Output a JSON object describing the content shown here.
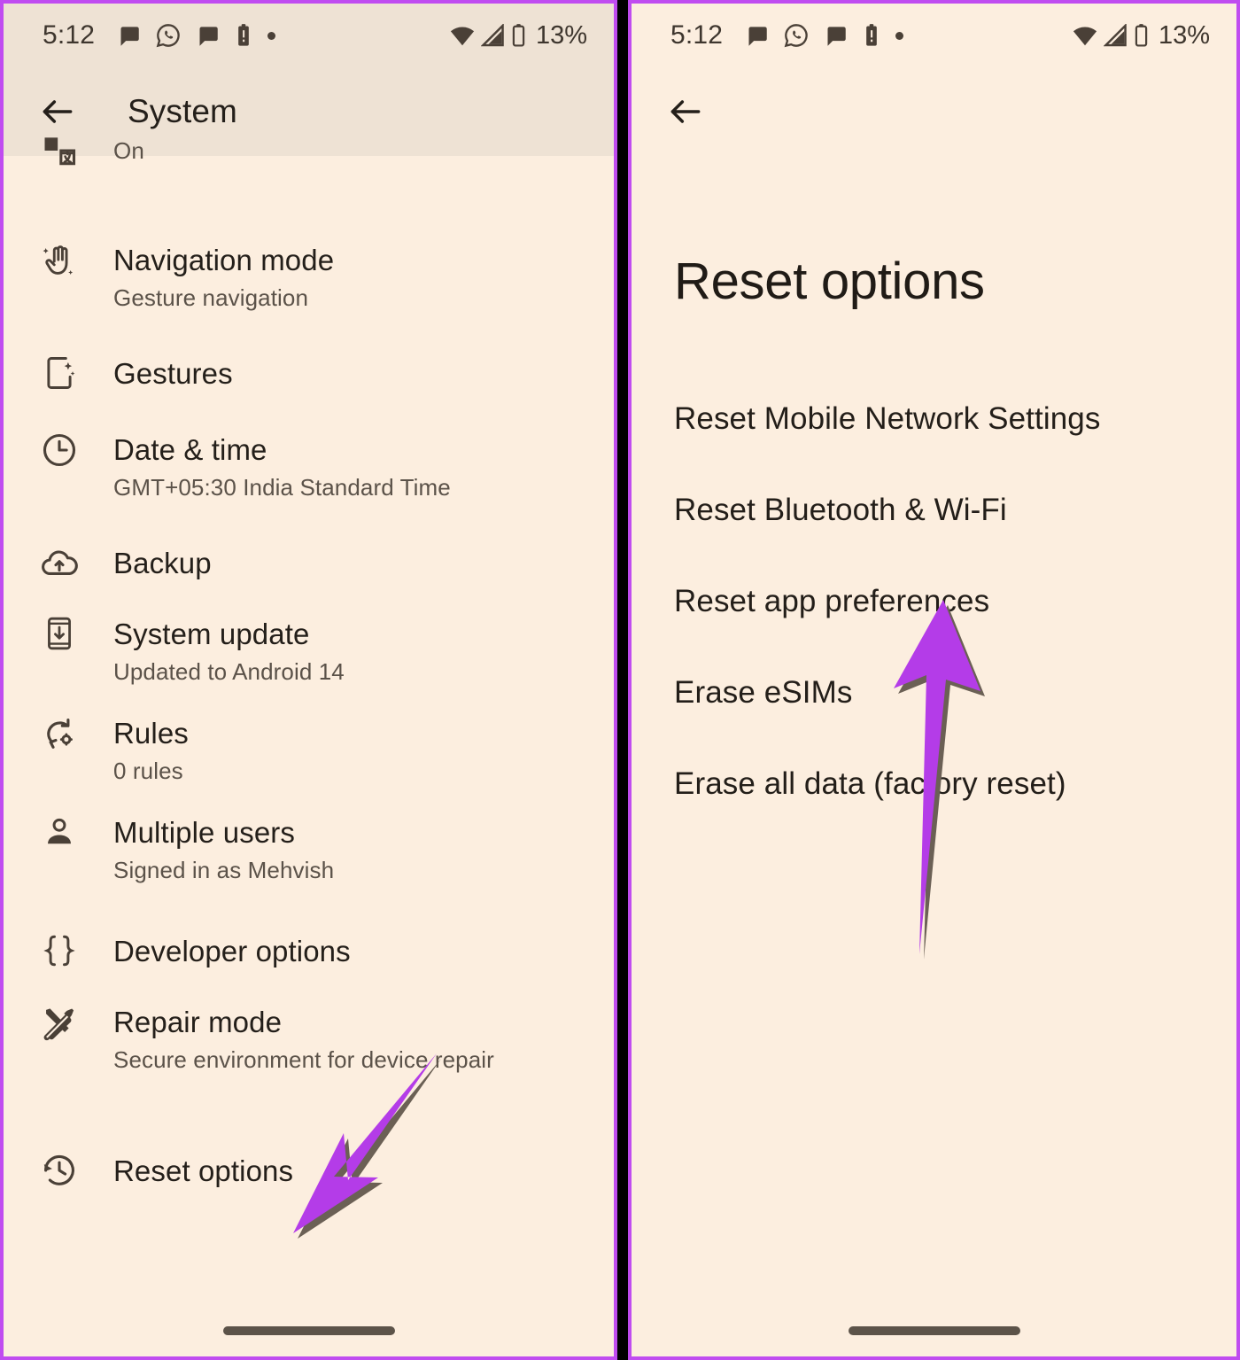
{
  "meta": {
    "accent_purple": "#B43CE8",
    "frame_border": "#C04CF0",
    "bg": "#FCEEDF",
    "appbar_bg": "#EEE2D4",
    "text_primary": "#241F1A",
    "text_secondary": "#5B5249"
  },
  "status_bar": {
    "time": "5:12",
    "battery_percent": "13%",
    "left_icons": [
      "chat-bubble-icon",
      "whatsapp-icon",
      "chat-bubble-icon",
      "battery-alert-icon",
      "dot-icon"
    ],
    "right_icons": [
      "wifi-icon",
      "cellular-signal-icon",
      "battery-icon"
    ]
  },
  "left_screen": {
    "appbar": {
      "back_icon": "back-arrow-icon",
      "title": "System"
    },
    "items": [
      {
        "icon": "translate-icon",
        "title": "",
        "subtitle": "On",
        "clipped": true
      },
      {
        "icon": "gesture-hand-icon",
        "title": "Navigation mode",
        "subtitle": "Gesture navigation",
        "clipped": false
      },
      {
        "icon": "phone-sparkle-icon",
        "title": "Gestures",
        "subtitle": "",
        "clipped": false
      },
      {
        "icon": "clock-icon",
        "title": "Date & time",
        "subtitle": "GMT+05:30 India Standard Time",
        "clipped": false
      },
      {
        "icon": "cloud-upload-icon",
        "title": "Backup",
        "subtitle": "",
        "clipped": false
      },
      {
        "icon": "system-update-icon",
        "title": "System update",
        "subtitle": "Updated to Android 14",
        "clipped": false
      },
      {
        "icon": "rules-gear-icon",
        "title": "Rules",
        "subtitle": "0 rules",
        "clipped": false
      },
      {
        "icon": "person-icon",
        "title": "Multiple users",
        "subtitle": "Signed in as Mehvish",
        "clipped": false
      },
      {
        "icon": "braces-icon",
        "title": "Developer options",
        "subtitle": "",
        "clipped": false
      },
      {
        "icon": "tools-icon",
        "title": "Repair mode",
        "subtitle": "Secure environment for device repair",
        "clipped": false
      },
      {
        "icon": "restore-history-icon",
        "title": "Reset options",
        "subtitle": "",
        "clipped": false
      }
    ],
    "annotation": {
      "name": "arrow-pointing-to-reset-options",
      "color": "#B43CE8"
    },
    "nav_pill": "gesture-nav-pill"
  },
  "right_screen": {
    "appbar": {
      "back_icon": "back-arrow-icon"
    },
    "title": "Reset options",
    "items": [
      {
        "label": "Reset Mobile Network Settings"
      },
      {
        "label": "Reset Bluetooth & Wi-Fi"
      },
      {
        "label": "Reset app preferences"
      },
      {
        "label": "Erase eSIMs"
      },
      {
        "label": "Erase all data (factory reset)"
      }
    ],
    "annotation": {
      "name": "arrow-pointing-to-reset-app-preferences",
      "color": "#B43CE8"
    },
    "nav_pill": "gesture-nav-pill"
  }
}
